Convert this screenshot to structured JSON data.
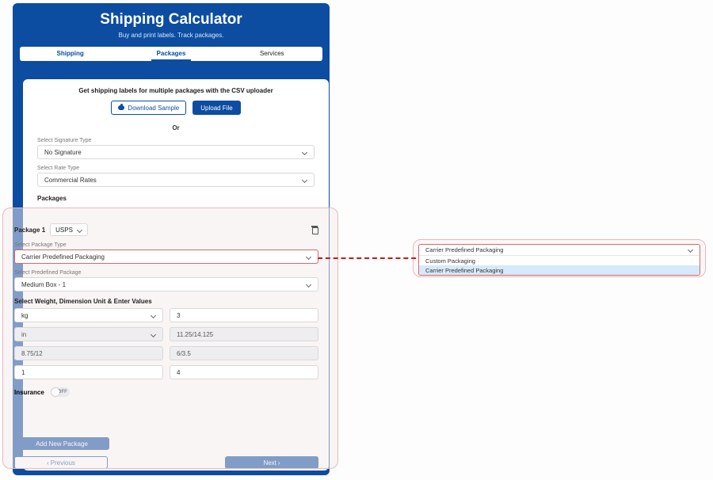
{
  "header": {
    "title": "Shipping Calculator",
    "subtitle": "Buy and print labels. Track packages."
  },
  "tabs": {
    "t1": "Shipping",
    "t2": "Packages",
    "t3": "Services"
  },
  "csv": {
    "line": "Get shipping labels for multiple packages with the CSV uploader",
    "download": "Download Sample",
    "upload": "Upload File",
    "or": "Or"
  },
  "sig": {
    "label": "Select Signature Type",
    "value": "No Signature"
  },
  "rate": {
    "label": "Select Rate Type",
    "value": "Commercial Rates"
  },
  "packages_label": "Packages",
  "pkg": {
    "title": "Package 1",
    "carrier": "USPS",
    "type_label": "Select Package Type",
    "type_value": "Carrier Predefined Packaging",
    "predef_label": "Select Predefined Package",
    "predef_value": "Medium Box - 1",
    "wdu_label": "Select Weight, Dimension Unit & Enter Values",
    "wunit": "kg",
    "weight": "3",
    "dunit": "in",
    "dimsL": "11.25/14.125",
    "dimsA": "8.75/12",
    "dimsB": "6/3.5",
    "qtyA": "1",
    "qtyB": "4",
    "insurance_label": "Insurance",
    "insurance_state": "OFF"
  },
  "footer": {
    "add": "Add New Package",
    "prev": "Previous",
    "next": "Next"
  },
  "dropdown": {
    "current": "Carrier Predefined Packaging",
    "opt1": "Custom Packaging",
    "opt2": "Carrier Predefined Packaging"
  }
}
